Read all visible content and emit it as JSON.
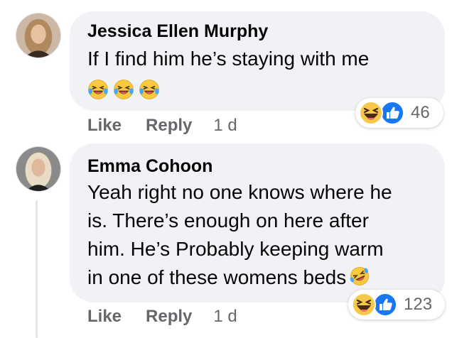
{
  "comments": [
    {
      "author": "Jessica Ellen Murphy",
      "text": "If I find him he’s staying with me",
      "emojis": [
        "laugh-cry-emoji",
        "laugh-cry-emoji",
        "laugh-cry-emoji"
      ],
      "actions": {
        "like": "Like",
        "reply": "Reply",
        "time": "1 d"
      },
      "reactions": {
        "icons": [
          "haha-reaction-icon",
          "like-reaction-icon"
        ],
        "count": "46"
      }
    },
    {
      "author": "Emma Cohoon",
      "text_lines": [
        "Yeah right no one knows where he",
        "is. There’s enough on here after",
        "him. He’s Probably keeping warm",
        "in one of these womens beds"
      ],
      "trailing_emoji": "rolling-laugh-emoji",
      "actions": {
        "like": "Like",
        "reply": "Reply",
        "time": "1 d"
      },
      "reactions": {
        "icons": [
          "haha-reaction-icon",
          "like-reaction-icon"
        ],
        "count": "123"
      }
    }
  ],
  "colors": {
    "bubble": "#f0f2f5",
    "text": "#050505",
    "meta": "#65676b",
    "like_blue": "#1877f2",
    "haha_yellow": "#f7c94b"
  }
}
